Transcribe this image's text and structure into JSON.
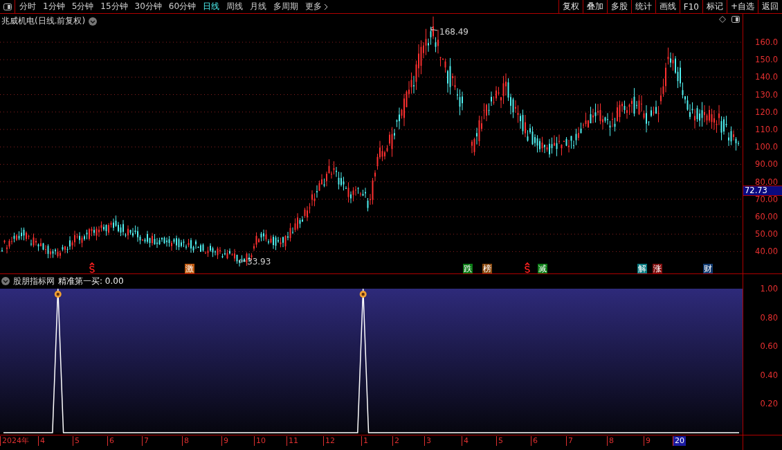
{
  "toolbar": {
    "periods": [
      {
        "label": "分时",
        "selected": false
      },
      {
        "label": "1分钟",
        "selected": false
      },
      {
        "label": "5分钟",
        "selected": false
      },
      {
        "label": "15分钟",
        "selected": false
      },
      {
        "label": "30分钟",
        "selected": false
      },
      {
        "label": "60分钟",
        "selected": false
      },
      {
        "label": "日线",
        "selected": true
      },
      {
        "label": "周线",
        "selected": false
      },
      {
        "label": "月线",
        "selected": false
      },
      {
        "label": "多周期",
        "selected": false
      }
    ],
    "more": "更多",
    "buttons": [
      "复权",
      "叠加",
      "多股",
      "统计",
      "画线",
      "F10",
      "标记",
      "+自选",
      "返回"
    ]
  },
  "main_chart": {
    "title": "兆威机电(日线.前复权)",
    "high_label": "168.49",
    "low_label": "33.93",
    "price_axis": [
      "160.0",
      "150.0",
      "140.0",
      "130.0",
      "120.0",
      "110.0",
      "100.0",
      "90.00",
      "80.00",
      "70.00",
      "60.00",
      "50.00",
      "40.00"
    ],
    "current_price": "72.73",
    "markers": [
      {
        "kind": "dollar"
      },
      {
        "kind": "badge",
        "label": "激",
        "color": "#c05a10"
      },
      {
        "kind": "badge",
        "label": "跌",
        "color": "#0a7a14"
      },
      {
        "kind": "badge",
        "label": "榜",
        "color": "#8a4a10"
      },
      {
        "kind": "dollar"
      },
      {
        "kind": "badge",
        "label": "减",
        "color": "#0a7a14"
      },
      {
        "kind": "badge",
        "label": "解",
        "color": "#0a7a80"
      },
      {
        "kind": "badge",
        "label": "涨",
        "color": "#801010"
      },
      {
        "kind": "badge",
        "label": "财",
        "color": "#103a70"
      }
    ]
  },
  "indicator": {
    "title": "股朋指标网",
    "reading": "精准第一买: 0.00",
    "chart_data": {
      "type": "line",
      "ylim": [
        0,
        1
      ],
      "yticks": [
        {
          "value": 1,
          "label": "1.00"
        },
        {
          "value": 0.8,
          "label": "0.80"
        },
        {
          "value": 0.6,
          "label": "0.60"
        },
        {
          "value": 0.4,
          "label": "0.40"
        },
        {
          "value": 0.2,
          "label": "0.20"
        }
      ],
      "series": [
        {
          "color": "#ffffff",
          "values": [
            0,
            0,
            0,
            0,
            0,
            0,
            0,
            0,
            0,
            0,
            1,
            0,
            0,
            0,
            0,
            0,
            0,
            0,
            0,
            0,
            0,
            0,
            0,
            0,
            0,
            0,
            0,
            0,
            0,
            0,
            0,
            0,
            0,
            0,
            0,
            0,
            0,
            0,
            0,
            0,
            0,
            0,
            0,
            0,
            0,
            0,
            0,
            0,
            0,
            0,
            0,
            0,
            0,
            0,
            0,
            0,
            0,
            0,
            0,
            0,
            0,
            0,
            0,
            0,
            0,
            0,
            1,
            0,
            0,
            0,
            0,
            0,
            0,
            0,
            0,
            0,
            0,
            0,
            0,
            0,
            0,
            0,
            0,
            0,
            0,
            0,
            0,
            0,
            0,
            0,
            0,
            0,
            0,
            0,
            0,
            0,
            0,
            0,
            0,
            0,
            0,
            0,
            0,
            0,
            0,
            0,
            0,
            0,
            0,
            0,
            0,
            0,
            0,
            0,
            0,
            0,
            0,
            0,
            0,
            0,
            0,
            0,
            0,
            0,
            0,
            0,
            0,
            0,
            0,
            0,
            0,
            0,
            0,
            0,
            0,
            0
          ]
        }
      ]
    }
  },
  "time_axis": [
    {
      "label": "2024年",
      "highlighted": false
    },
    {
      "label": "4",
      "highlighted": false
    },
    {
      "label": "5",
      "highlighted": false
    },
    {
      "label": "6",
      "highlighted": false
    },
    {
      "label": "7",
      "highlighted": false
    },
    {
      "label": "8",
      "highlighted": false
    },
    {
      "label": "9",
      "highlighted": false
    },
    {
      "label": "10",
      "highlighted": false
    },
    {
      "label": "11",
      "highlighted": false
    },
    {
      "label": "12",
      "highlighted": false
    },
    {
      "label": "1",
      "highlighted": false
    },
    {
      "label": "2",
      "highlighted": false
    },
    {
      "label": "3",
      "highlighted": false
    },
    {
      "label": "4",
      "highlighted": false
    },
    {
      "label": "5",
      "highlighted": false
    },
    {
      "label": "6",
      "highlighted": false
    },
    {
      "label": "7",
      "highlighted": false
    },
    {
      "label": "8",
      "highlighted": false
    },
    {
      "label": "9",
      "highlighted": false
    },
    {
      "label": "20",
      "highlighted": true
    }
  ]
}
